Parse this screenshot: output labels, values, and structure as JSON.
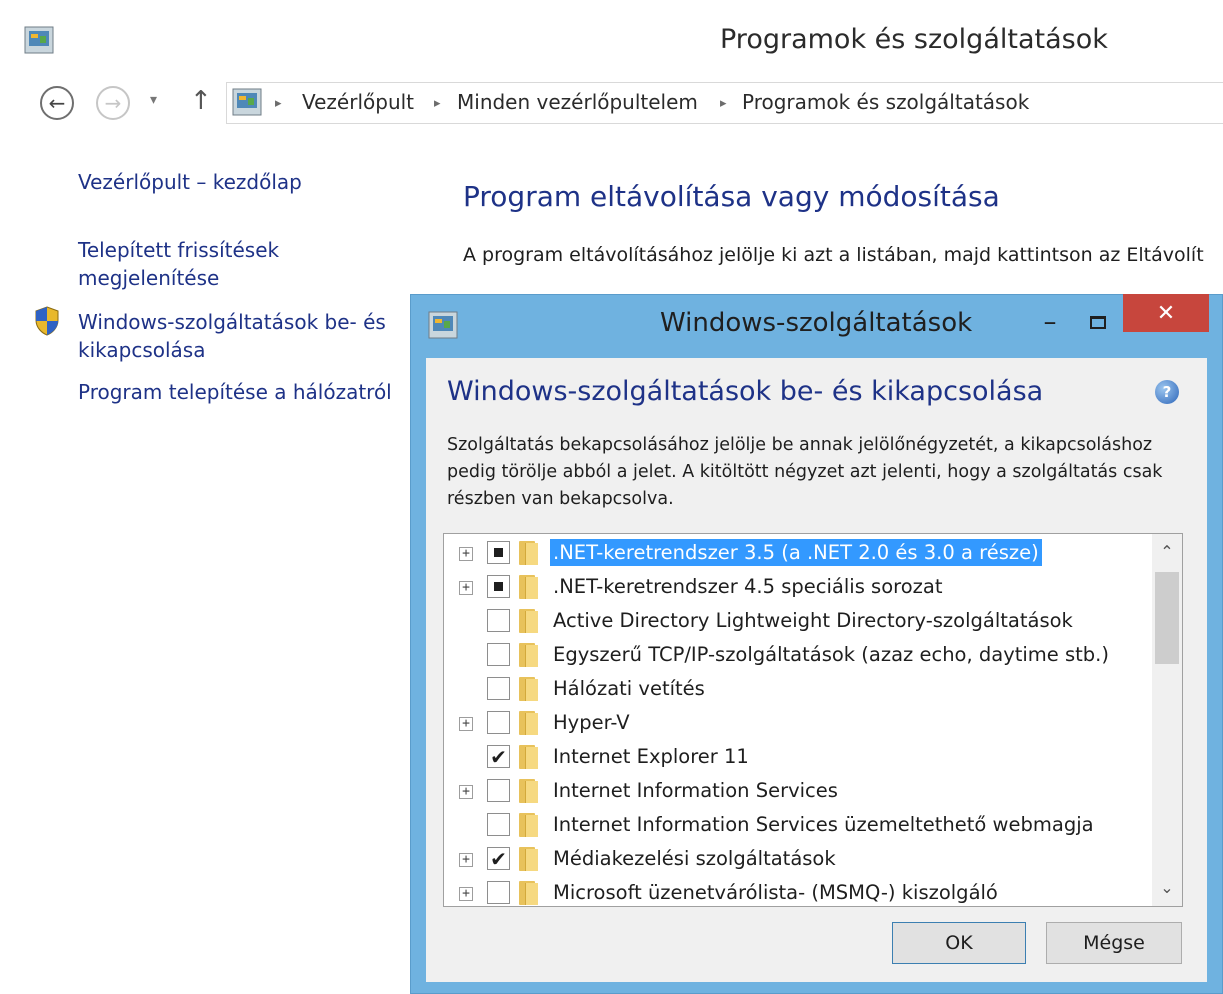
{
  "window": {
    "title": "Programok és szolgáltatások"
  },
  "address": {
    "separator": "▸",
    "crumbs": [
      "Vezérlőpult",
      "Minden vezérlőpultelem",
      "Programok és szolgáltatások"
    ]
  },
  "left_pane": {
    "links": [
      "Vezérlőpult – kezdőlap",
      "Telepített frissítések",
      "megjelenítése",
      "Windows-szolgáltatások be- és",
      "kikapcsolása",
      "Program telepítése a hálózatról"
    ]
  },
  "main": {
    "title": "Program eltávolítása vagy módosítása",
    "description": "A program eltávolításához jelölje ki azt a listában, majd kattintson az Eltávolít"
  },
  "dialog": {
    "title": "Windows-szolgáltatások",
    "minimize_glyph": "–",
    "close_glyph": "✕",
    "help_glyph": "?",
    "heading": "Windows-szolgáltatások be- és kikapcsolása",
    "description": "Szolgáltatás bekapcsolásához jelölje be annak jelölőnégyzetét, a kikapcsoláshoz pedig törölje abból a jelet. A kitöltött négyzet azt jelenti, hogy a szolgáltatás csak részben van bekapcsolva.",
    "features": [
      {
        "label": ".NET-keretrendszer 3.5 (a .NET 2.0 és 3.0 a része)",
        "state": "partial",
        "expandable": true,
        "selected": true
      },
      {
        "label": ".NET-keretrendszer 4.5 speciális sorozat",
        "state": "partial",
        "expandable": true,
        "selected": false
      },
      {
        "label": "Active Directory Lightweight Directory-szolgáltatások",
        "state": "unchecked",
        "expandable": false,
        "selected": false
      },
      {
        "label": "Egyszerű TCP/IP-szolgáltatások (azaz echo, daytime stb.)",
        "state": "unchecked",
        "expandable": false,
        "selected": false
      },
      {
        "label": "Hálózati vetítés",
        "state": "unchecked",
        "expandable": false,
        "selected": false
      },
      {
        "label": "Hyper-V",
        "state": "unchecked",
        "expandable": true,
        "selected": false
      },
      {
        "label": "Internet Explorer 11",
        "state": "checked",
        "expandable": false,
        "selected": false
      },
      {
        "label": "Internet Information Services",
        "state": "unchecked",
        "expandable": true,
        "selected": false
      },
      {
        "label": "Internet Information Services üzemeltethető webmagja",
        "state": "unchecked",
        "expandable": false,
        "selected": false
      },
      {
        "label": "Médiakezelési szolgáltatások",
        "state": "checked",
        "expandable": true,
        "selected": false
      },
      {
        "label": "Microsoft üzenetvárólista- (MSMQ-) kiszolgáló",
        "state": "unchecked",
        "expandable": true,
        "selected": false
      }
    ],
    "ok_label": "OK",
    "cancel_label": "Mégse"
  },
  "colors": {
    "link": "#1e3287",
    "selection": "#3399ff",
    "dialog_frame": "#6fb2e0",
    "close_button": "#c7463d"
  },
  "icons": {
    "navigation": [
      "back-arrow-icon",
      "forward-arrow-icon",
      "recent-pages-icon",
      "up-arrow-icon"
    ],
    "glyphs": {
      "back": "←",
      "forward": "→",
      "recent": "▾",
      "up": "↑",
      "scroll_up": "⌃",
      "scroll_down": "⌄",
      "expand": "+",
      "tick": "✔"
    }
  }
}
